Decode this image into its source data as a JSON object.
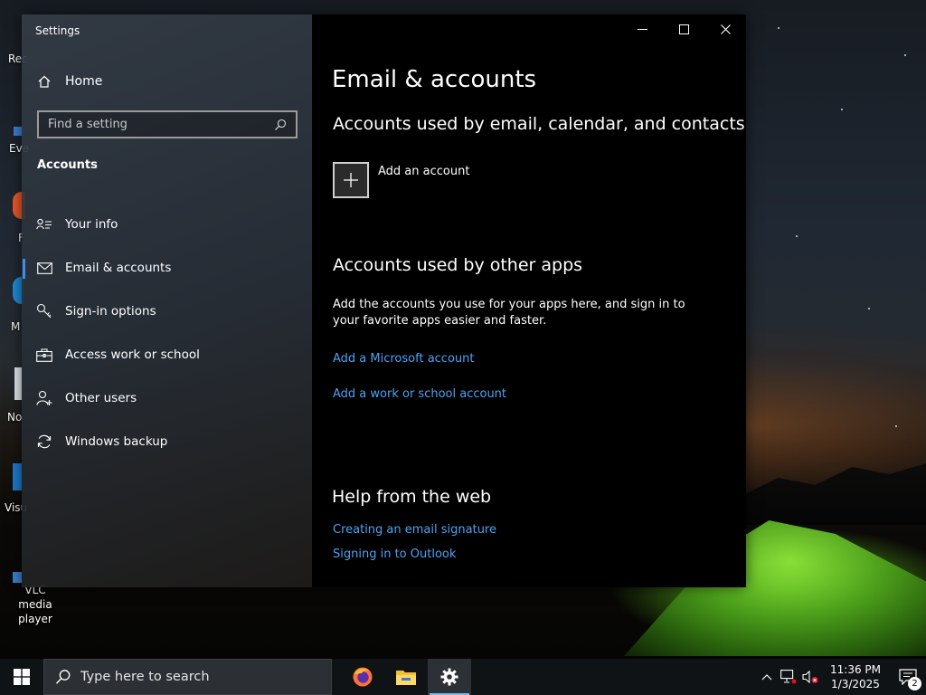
{
  "desktop": {
    "icons": [
      {
        "label": "Rec",
        "name": "recycle-bin"
      },
      {
        "label": "Eve",
        "name": "everything"
      },
      {
        "label": "F",
        "name": "firefox"
      },
      {
        "label": "M",
        "name": "edge"
      },
      {
        "label": "No",
        "name": "notepad"
      },
      {
        "label": "Visu",
        "name": "vscode"
      },
      {
        "label": "VLC media player",
        "name": "vlc"
      }
    ]
  },
  "window": {
    "app_title": "Settings",
    "controls": {
      "minimize": "minimize-icon",
      "maximize": "maximize-icon",
      "close": "close-icon"
    }
  },
  "sidebar": {
    "home_label": "Home",
    "search_placeholder": "Find a setting",
    "section_title": "Accounts",
    "items": [
      {
        "label": "Your info",
        "icon": "user-card-icon",
        "active": false
      },
      {
        "label": "Email & accounts",
        "icon": "mail-icon",
        "active": true
      },
      {
        "label": "Sign-in options",
        "icon": "key-icon",
        "active": false
      },
      {
        "label": "Access work or school",
        "icon": "briefcase-icon",
        "active": false
      },
      {
        "label": "Other users",
        "icon": "person-add-icon",
        "active": false
      },
      {
        "label": "Windows backup",
        "icon": "sync-icon",
        "active": false
      }
    ]
  },
  "content": {
    "page_title": "Email & accounts",
    "email_section": {
      "heading": "Accounts used by email, calendar, and contacts",
      "add_account_label": "Add an account"
    },
    "apps_section": {
      "heading": "Accounts used by other apps",
      "description": "Add the accounts you use for your apps here, and sign in to your favorite apps easier and faster.",
      "links": [
        "Add a Microsoft account",
        "Add a work or school account"
      ]
    },
    "help_section": {
      "heading": "Help from the web",
      "links": [
        "Creating an email signature",
        "Signing in to Outlook"
      ]
    }
  },
  "taskbar": {
    "search_placeholder": "Type here to search",
    "apps": [
      {
        "name": "firefox",
        "active": false
      },
      {
        "name": "file-explorer",
        "active": false
      },
      {
        "name": "settings",
        "active": true
      }
    ],
    "clock": {
      "time": "11:36 PM",
      "date": "1/3/2025"
    },
    "notification_count": "2"
  },
  "colors": {
    "accent": "#3b8eea",
    "link": "#4ba3f5",
    "content_bg": "#000000",
    "taskbar_bg": "#101316"
  }
}
